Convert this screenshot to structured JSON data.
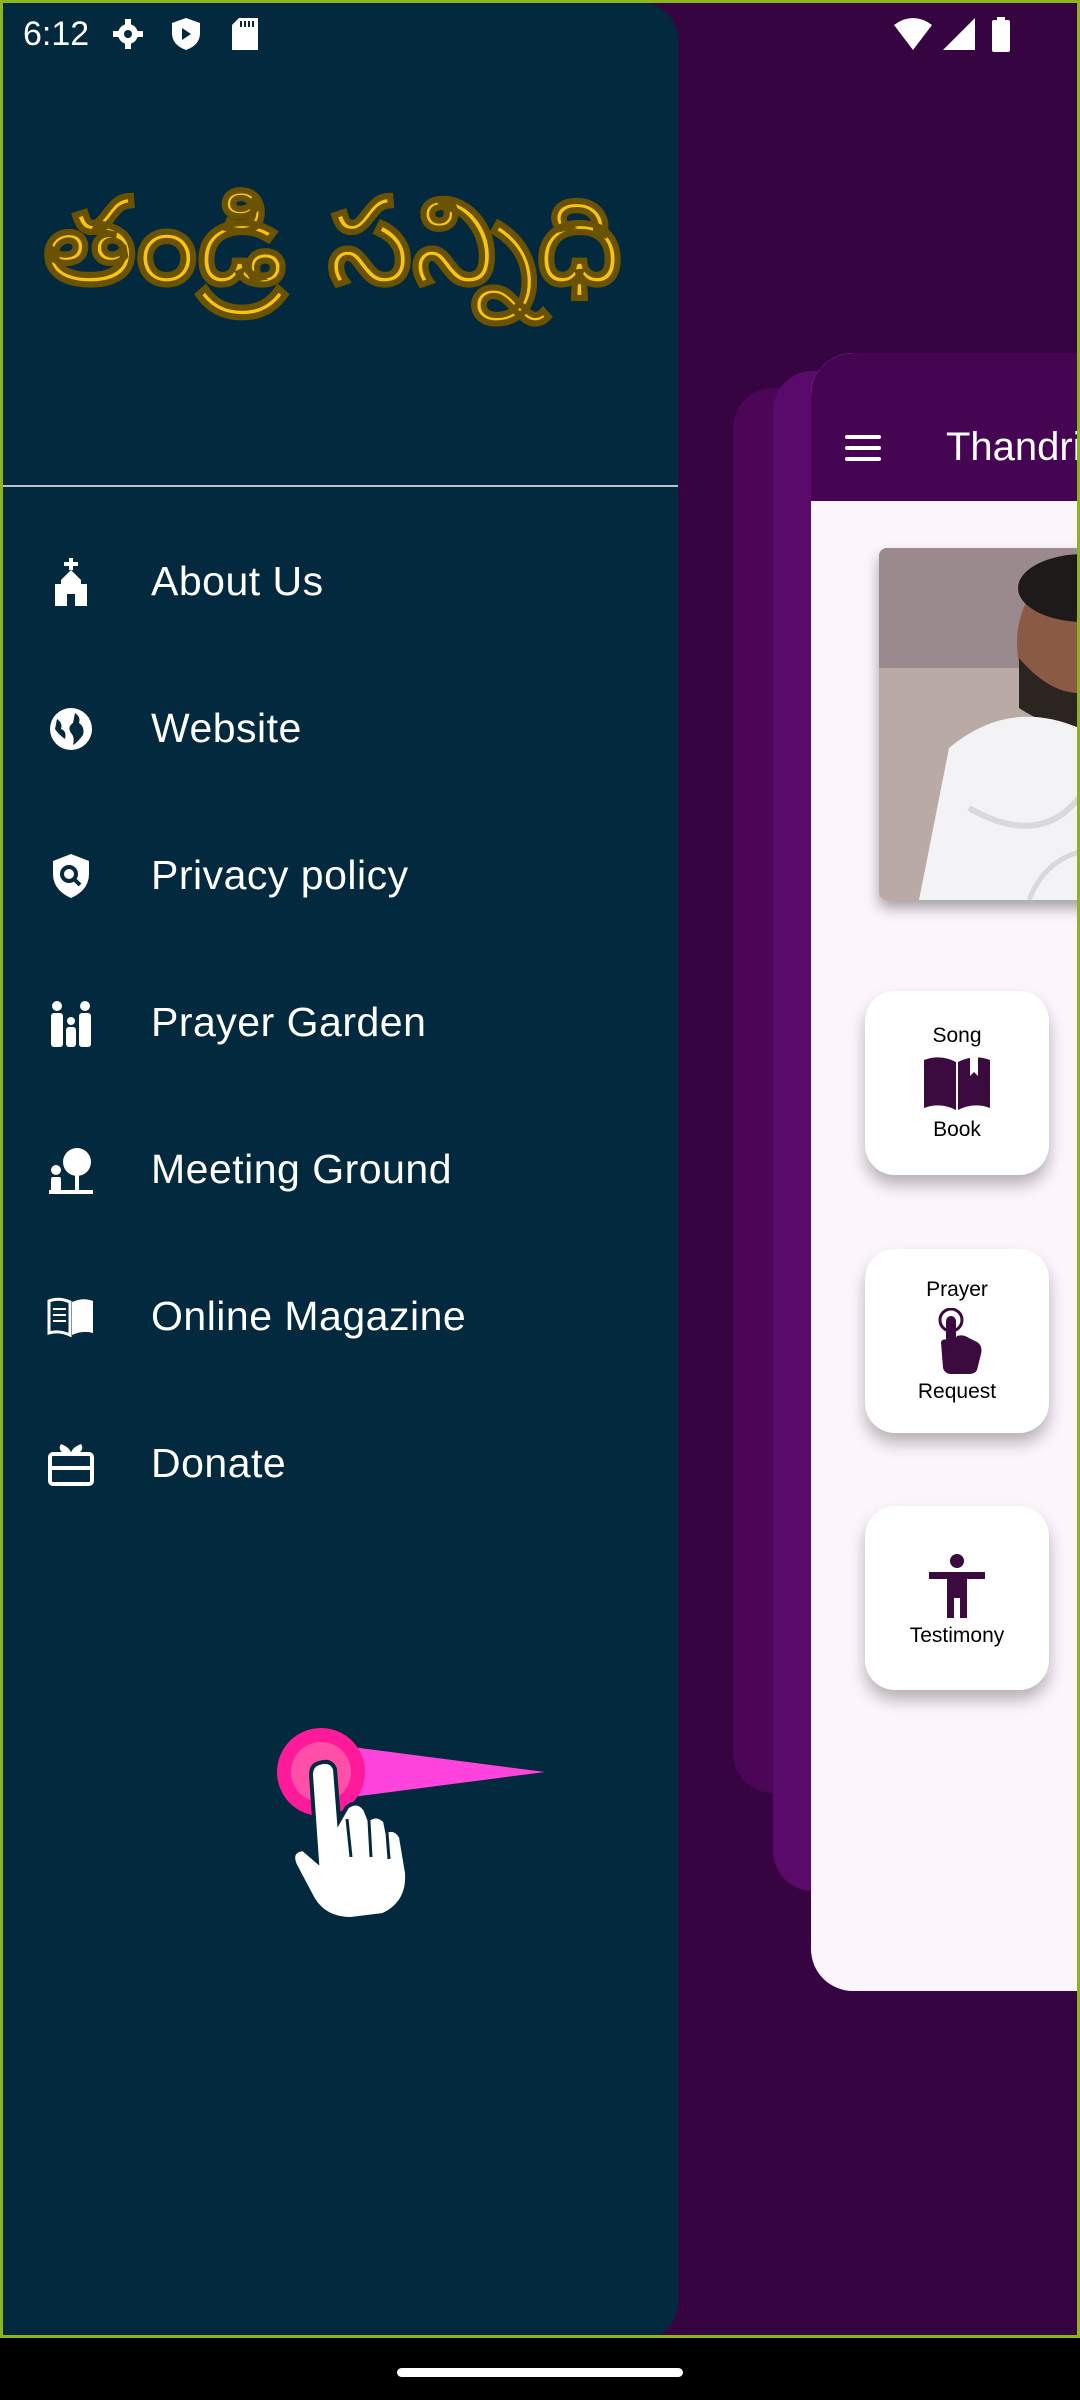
{
  "status_bar": {
    "time": "6:12",
    "icons": [
      "settings-icon",
      "shield-icon",
      "sd-card-icon",
      "wifi-icon",
      "cell-signal-icon",
      "battery-icon"
    ]
  },
  "drawer": {
    "logo_text": "తండ్రి సన్నిధి",
    "items": [
      {
        "label": "About Us",
        "icon": "church-icon"
      },
      {
        "label": "Website",
        "icon": "globe-icon"
      },
      {
        "label": "Privacy policy",
        "icon": "privacy-shield-icon"
      },
      {
        "label": "Prayer Garden",
        "icon": "family-icon"
      },
      {
        "label": "Meeting Ground",
        "icon": "park-icon"
      },
      {
        "label": "Online Magazine",
        "icon": "open-book-icon"
      },
      {
        "label": "Donate",
        "icon": "gift-card-icon"
      }
    ]
  },
  "app": {
    "title": "Thandri Sannidhi",
    "tiles": [
      {
        "line1": "Song",
        "line2": "Book",
        "icon": "book-icon"
      },
      {
        "line1": "Prayer",
        "line2": "Request",
        "icon": "tap-hand-icon"
      },
      {
        "line1": "",
        "line2": "Testimony",
        "icon": "person-arms-open-icon"
      }
    ]
  },
  "colors": {
    "drawer_bg": "#03293f",
    "app_bar": "#460552",
    "backdrop": "#370442",
    "logo_gold": "#f6c514",
    "gesture_pink": "#ff3fd8"
  }
}
